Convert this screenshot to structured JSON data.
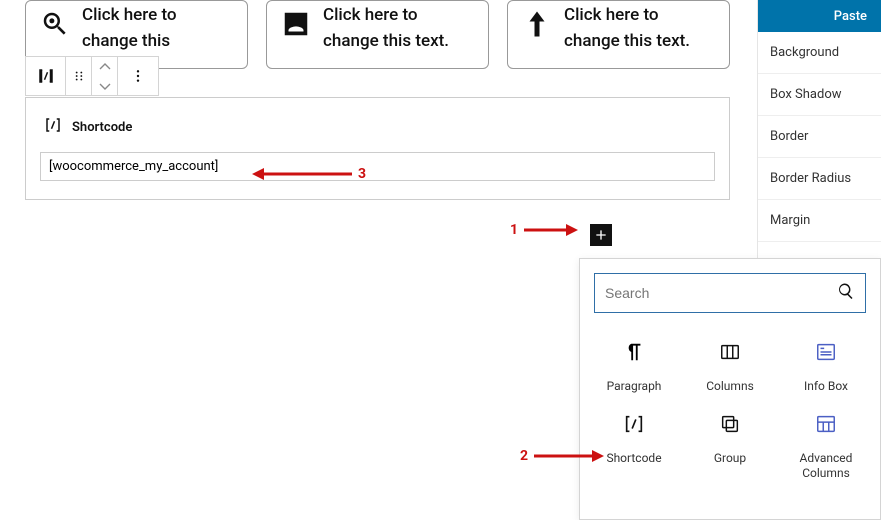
{
  "info_boxes": [
    {
      "text": "Click here to change this"
    },
    {
      "text": "Click here to change this text."
    },
    {
      "text": "Click here to change this text."
    }
  ],
  "shortcode_block": {
    "label": "Shortcode",
    "value": "[woocommerce_my_account]"
  },
  "sidebar": {
    "tab_paste": "Paste",
    "items": [
      "Background",
      "Box Shadow",
      "Border",
      "Border Radius",
      "Margin"
    ]
  },
  "inserter": {
    "search_placeholder": "Search",
    "blocks": [
      {
        "label": "Paragraph"
      },
      {
        "label": "Columns"
      },
      {
        "label": "Info Box"
      },
      {
        "label": "Shortcode"
      },
      {
        "label": "Group"
      },
      {
        "label": "Advanced Columns"
      }
    ]
  },
  "annotations": {
    "a1": "1",
    "a2": "2",
    "a3": "3"
  },
  "colors": {
    "accent": "#0073aa",
    "arrow": "#cc1111"
  }
}
